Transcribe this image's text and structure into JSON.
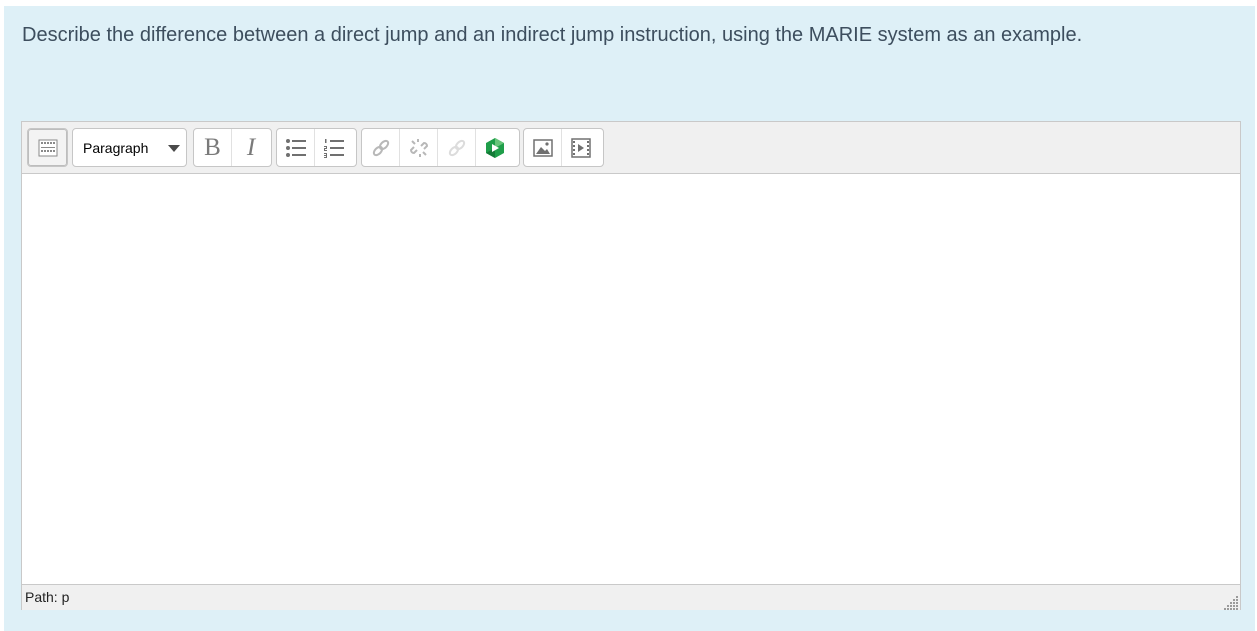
{
  "question": {
    "text": "Describe the difference between a direct jump and an indirect jump instruction, using the MARIE system as an example."
  },
  "toolbar": {
    "toggle_icon": "toolbar-toggle-icon",
    "format_select": {
      "value": "Paragraph"
    },
    "bold_label": "B",
    "italic_label": "I",
    "list_icons": [
      "unordered-list-icon",
      "ordered-list-icon"
    ],
    "link_icons": [
      "link-icon",
      "unlink-icon",
      "anchor-icon",
      "recording-icon"
    ],
    "media_icons": [
      "image-icon",
      "media-icon"
    ]
  },
  "editor": {
    "content": ""
  },
  "statusbar": {
    "path": "Path: p"
  },
  "colors": {
    "panel_background": "#def0f7",
    "question_text": "#3d4e5e",
    "toolbar_background": "#f0f0f0",
    "record_icon_green": "#1f9e4a"
  }
}
